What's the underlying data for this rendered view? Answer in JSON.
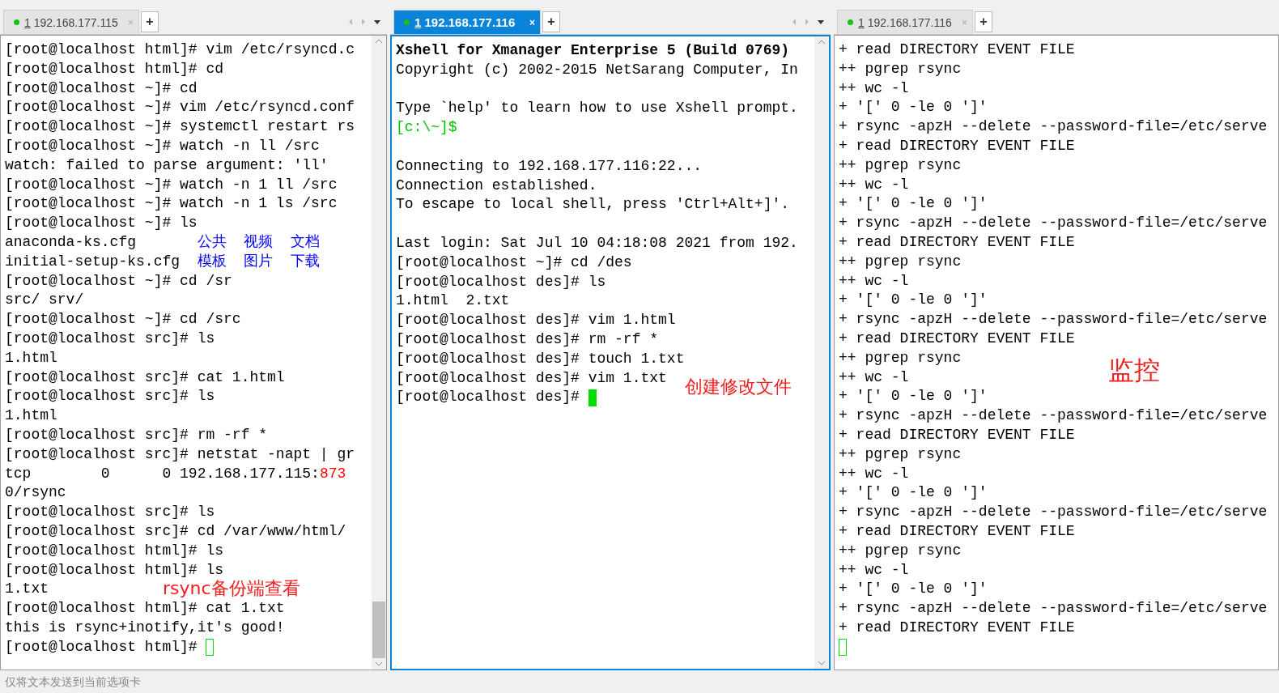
{
  "panes": [
    {
      "tab": {
        "number": "1",
        "label": "192.168.177.115",
        "selected": false,
        "close": "×",
        "add": "+"
      },
      "lines": [
        {
          "kind": "plain",
          "text": "[root@localhost html]# vim /etc/rsyncd.c"
        },
        {
          "kind": "plain",
          "text": "[root@localhost html]# cd"
        },
        {
          "kind": "plain",
          "text": "[root@localhost ~]# cd"
        },
        {
          "kind": "plain",
          "text": "[root@localhost ~]# vim /etc/rsyncd.conf"
        },
        {
          "kind": "plain",
          "text": "[root@localhost ~]# systemctl restart rs"
        },
        {
          "kind": "plain",
          "text": "[root@localhost ~]# watch -n ll /src"
        },
        {
          "kind": "plain",
          "text": "watch: failed to parse argument: 'll'"
        },
        {
          "kind": "plain",
          "text": "[root@localhost ~]# watch -n 1 ll /src"
        },
        {
          "kind": "plain",
          "text": "[root@localhost ~]# watch -n 1 ls /src"
        },
        {
          "kind": "plain",
          "text": "[root@localhost ~]# ls"
        },
        {
          "kind": "mixed",
          "parts": [
            {
              "text": "anaconda-ks.cfg       "
            },
            {
              "text": "公共  视频  文档",
              "color": "#0000ff"
            }
          ]
        },
        {
          "kind": "mixed",
          "parts": [
            {
              "text": "initial-setup-ks.cfg  "
            },
            {
              "text": "模板  图片  下载",
              "color": "#0000ff"
            }
          ]
        },
        {
          "kind": "plain",
          "text": "[root@localhost ~]# cd /sr"
        },
        {
          "kind": "plain",
          "text": "src/ srv/"
        },
        {
          "kind": "plain",
          "text": "[root@localhost ~]# cd /src"
        },
        {
          "kind": "plain",
          "text": "[root@localhost src]# ls"
        },
        {
          "kind": "plain",
          "text": "1.html"
        },
        {
          "kind": "plain",
          "text": "[root@localhost src]# cat 1.html"
        },
        {
          "kind": "plain",
          "text": "[root@localhost src]# ls"
        },
        {
          "kind": "plain",
          "text": "1.html"
        },
        {
          "kind": "plain",
          "text": "[root@localhost src]# rm -rf *"
        },
        {
          "kind": "plain",
          "text": "[root@localhost src]# netstat -napt | gr"
        },
        {
          "kind": "mixed",
          "parts": [
            {
              "text": "tcp        0      0 192.168.177.115:"
            },
            {
              "text": "873",
              "color": "#ff0000"
            }
          ]
        },
        {
          "kind": "plain",
          "text": "0/rsync"
        },
        {
          "kind": "plain",
          "text": "[root@localhost src]# ls"
        },
        {
          "kind": "plain",
          "text": "[root@localhost src]# cd /var/www/html/"
        },
        {
          "kind": "plain",
          "text": "[root@localhost html]# ls"
        },
        {
          "kind": "plain",
          "text": "[root@localhost html]# ls"
        },
        {
          "kind": "plain",
          "text": "1.txt"
        },
        {
          "kind": "plain",
          "text": "[root@localhost html]# cat 1.txt"
        },
        {
          "kind": "plain",
          "text": "this is rsync+inotify,it's good!"
        },
        {
          "kind": "plain",
          "text": "[root@localhost html]# ",
          "cursor_filled": false
        }
      ],
      "annotation": "rsync备份端查看",
      "scrollbar": {
        "thumb": true
      }
    },
    {
      "tab": {
        "number": "1",
        "label": "192.168.177.116",
        "selected": true,
        "close": "×",
        "add": "+"
      },
      "lines": [
        {
          "kind": "bold",
          "text": "Xshell for Xmanager Enterprise 5 (Build 0769)"
        },
        {
          "kind": "plain",
          "text": "Copyright (c) 2002-2015 NetSarang Computer, In"
        },
        {
          "kind": "blank"
        },
        {
          "kind": "plain",
          "text": "Type `help' to learn how to use Xshell prompt."
        },
        {
          "kind": "mixed",
          "parts": [
            {
              "text": "[c:\\~]$",
              "color": "#00c000"
            }
          ]
        },
        {
          "kind": "blank"
        },
        {
          "kind": "plain",
          "text": "Connecting to 192.168.177.116:22..."
        },
        {
          "kind": "plain",
          "text": "Connection established."
        },
        {
          "kind": "plain",
          "text": "To escape to local shell, press 'Ctrl+Alt+]'."
        },
        {
          "kind": "blank"
        },
        {
          "kind": "plain",
          "text": "Last login: Sat Jul 10 04:18:08 2021 from 192."
        },
        {
          "kind": "plain",
          "text": "[root@localhost ~]# cd /des"
        },
        {
          "kind": "plain",
          "text": "[root@localhost des]# ls"
        },
        {
          "kind": "plain",
          "text": "1.html  2.txt"
        },
        {
          "kind": "plain",
          "text": "[root@localhost des]# vim 1.html"
        },
        {
          "kind": "plain",
          "text": "[root@localhost des]# rm -rf *"
        },
        {
          "kind": "plain",
          "text": "[root@localhost des]# touch 1.txt"
        },
        {
          "kind": "plain",
          "text": "[root@localhost des]# vim 1.txt"
        },
        {
          "kind": "plain",
          "text": "[root@localhost des]# ",
          "cursor_filled": true
        }
      ],
      "annotation": "创建修改文件",
      "scrollbar": {
        "thumb": false
      }
    },
    {
      "tab": {
        "number": "1",
        "label": "192.168.177.116",
        "selected": false,
        "close": "×",
        "add": "+"
      },
      "lines": [
        {
          "kind": "plain",
          "text": "+ read DIRECTORY EVENT FILE"
        },
        {
          "kind": "plain",
          "text": "++ pgrep rsync"
        },
        {
          "kind": "plain",
          "text": "++ wc -l"
        },
        {
          "kind": "plain",
          "text": "+ '[' 0 -le 0 ']'"
        },
        {
          "kind": "plain",
          "text": "+ rsync -apzH --delete --password-file=/etc/serve"
        },
        {
          "kind": "plain",
          "text": "+ read DIRECTORY EVENT FILE"
        },
        {
          "kind": "plain",
          "text": "++ pgrep rsync"
        },
        {
          "kind": "plain",
          "text": "++ wc -l"
        },
        {
          "kind": "plain",
          "text": "+ '[' 0 -le 0 ']'"
        },
        {
          "kind": "plain",
          "text": "+ rsync -apzH --delete --password-file=/etc/serve"
        },
        {
          "kind": "plain",
          "text": "+ read DIRECTORY EVENT FILE"
        },
        {
          "kind": "plain",
          "text": "++ pgrep rsync"
        },
        {
          "kind": "plain",
          "text": "++ wc -l"
        },
        {
          "kind": "plain",
          "text": "+ '[' 0 -le 0 ']'"
        },
        {
          "kind": "plain",
          "text": "+ rsync -apzH --delete --password-file=/etc/serve"
        },
        {
          "kind": "plain",
          "text": "+ read DIRECTORY EVENT FILE"
        },
        {
          "kind": "plain",
          "text": "++ pgrep rsync"
        },
        {
          "kind": "plain",
          "text": "++ wc -l"
        },
        {
          "kind": "plain",
          "text": "+ '[' 0 -le 0 ']'"
        },
        {
          "kind": "plain",
          "text": "+ rsync -apzH --delete --password-file=/etc/serve"
        },
        {
          "kind": "plain",
          "text": "+ read DIRECTORY EVENT FILE"
        },
        {
          "kind": "plain",
          "text": "++ pgrep rsync"
        },
        {
          "kind": "plain",
          "text": "++ wc -l"
        },
        {
          "kind": "plain",
          "text": "+ '[' 0 -le 0 ']'"
        },
        {
          "kind": "plain",
          "text": "+ rsync -apzH --delete --password-file=/etc/serve"
        },
        {
          "kind": "plain",
          "text": "+ read DIRECTORY EVENT FILE"
        },
        {
          "kind": "plain",
          "text": "++ pgrep rsync"
        },
        {
          "kind": "plain",
          "text": "++ wc -l"
        },
        {
          "kind": "plain",
          "text": "+ '[' 0 -le 0 ']'"
        },
        {
          "kind": "plain",
          "text": "+ rsync -apzH --delete --password-file=/etc/serve"
        },
        {
          "kind": "plain",
          "text": "+ read DIRECTORY EVENT FILE"
        },
        {
          "kind": "blank",
          "cursor_filled": false
        }
      ],
      "annotation": "监控"
    }
  ],
  "status_bar": {
    "placeholder": "仅将文本发送到当前选项卡"
  }
}
